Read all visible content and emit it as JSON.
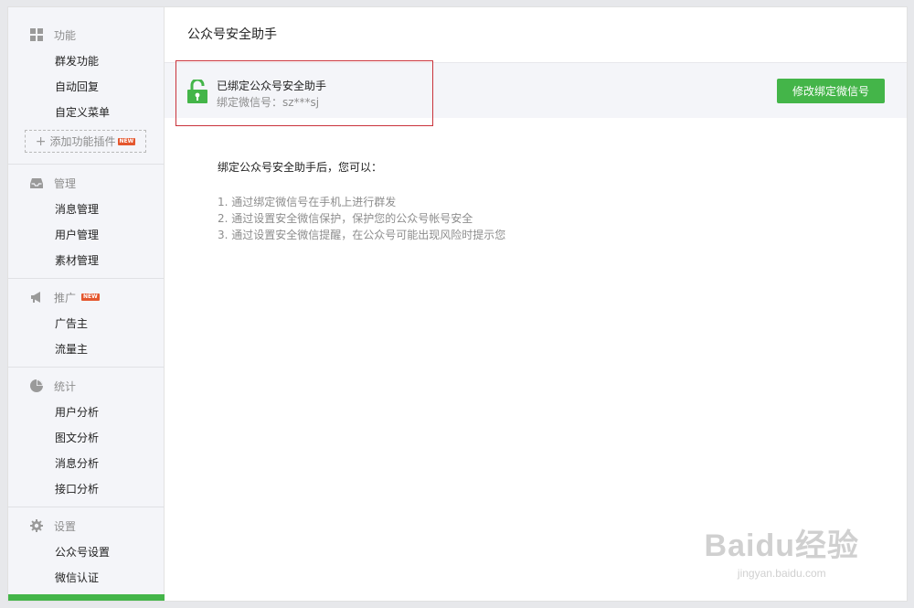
{
  "sidebar": {
    "groups": [
      {
        "title": "功能",
        "icon": "grid-icon",
        "items": [
          {
            "label": "群发功能"
          },
          {
            "label": "自动回复"
          },
          {
            "label": "自定义菜单"
          }
        ],
        "add_plugin": {
          "label": "添加功能插件",
          "badge": "NEW"
        }
      },
      {
        "title": "管理",
        "icon": "inbox-icon",
        "items": [
          {
            "label": "消息管理"
          },
          {
            "label": "用户管理"
          },
          {
            "label": "素材管理"
          }
        ]
      },
      {
        "title": "推广",
        "icon": "megaphone-icon",
        "badge": "NEW",
        "items": [
          {
            "label": "广告主"
          },
          {
            "label": "流量主"
          }
        ]
      },
      {
        "title": "统计",
        "icon": "pie-chart-icon",
        "items": [
          {
            "label": "用户分析"
          },
          {
            "label": "图文分析"
          },
          {
            "label": "消息分析"
          },
          {
            "label": "接口分析"
          }
        ]
      },
      {
        "title": "设置",
        "icon": "gear-icon",
        "items": [
          {
            "label": "公众号设置"
          },
          {
            "label": "微信认证"
          }
        ]
      }
    ]
  },
  "main": {
    "title": "公众号安全助手",
    "binding": {
      "status": "已绑定公众号安全助手",
      "account": "绑定微信号：sz***sj",
      "button": "修改绑定微信号"
    },
    "description": {
      "heading": "绑定公众号安全助手后，您可以：",
      "items": [
        "1. 通过绑定微信号在手机上进行群发",
        "2. 通过设置安全微信保护，保护您的公众号帐号安全",
        "3. 通过设置安全微信提醒，在公众号可能出现风险时提示您"
      ]
    }
  },
  "watermark": {
    "brand": "Baidu经验",
    "url": "jingyan.baidu.com"
  },
  "colors": {
    "accent": "#44b549",
    "highlight_border": "#c9333b",
    "sidebar_bg": "#f4f5f9",
    "badge": "#e4572e"
  }
}
